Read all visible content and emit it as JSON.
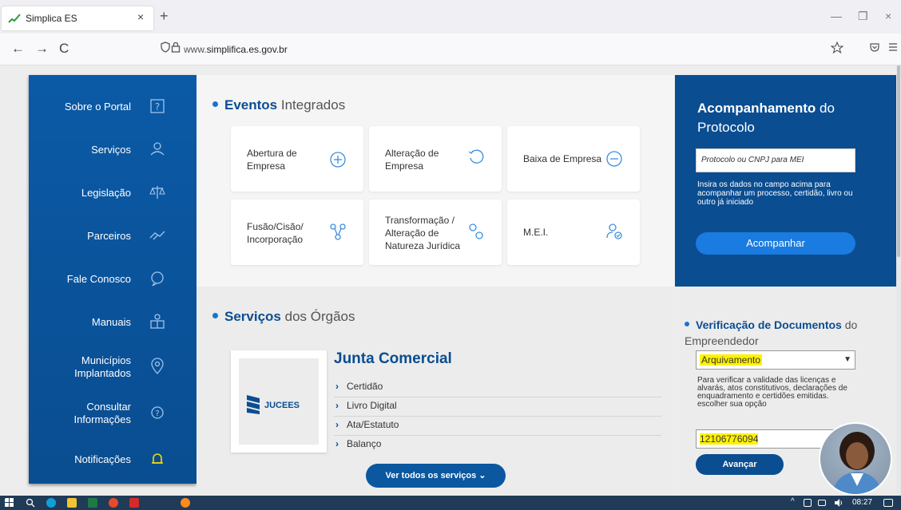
{
  "browser": {
    "tab_title": "Simplica ES",
    "tab_close": "×",
    "new_tab": "+",
    "url_host": "www.",
    "url_domain": "simplifica.es.gov.br",
    "back": "←",
    "forward": "→",
    "reload": "C",
    "minimize": "—",
    "restore": "❐",
    "close": "×",
    "bookmark_icon": "star-icon",
    "shield_icon": "shield-icon",
    "menu_icon": "hamburger-icon"
  },
  "sidebar": {
    "items": [
      {
        "label": "Sobre o Portal",
        "icon": "question-icon"
      },
      {
        "label": "Serviços",
        "icon": "user-service-icon"
      },
      {
        "label": "Legislação",
        "icon": "scales-icon"
      },
      {
        "label": "Parceiros",
        "icon": "handshake-icon"
      },
      {
        "label": "Fale Conosco",
        "icon": "chat-icon"
      },
      {
        "label": "Manuais",
        "icon": "book-icon"
      },
      {
        "label_line1": "Municípios",
        "label_line2": "Implantados",
        "icon": "location-icon"
      },
      {
        "label_line1": "Consultar",
        "label_line2": "Informações",
        "icon": "help-circle-icon"
      },
      {
        "label": "Notificações",
        "icon": "bell-icon"
      }
    ]
  },
  "eventos": {
    "title_bold": "Eventos",
    "title_rest": "Integrados",
    "cards": [
      {
        "line1": "Abertura de",
        "line2": "Empresa",
        "icon": "plus-circle-icon"
      },
      {
        "line1": "Alteração de",
        "line2": "Empresa",
        "icon": "refresh-icon"
      },
      {
        "line1": "Baixa de Empresa",
        "icon": "minus-circle-icon"
      },
      {
        "line1": "Fusão/Cisão/",
        "line2": "Incorporação",
        "icon": "merge-icon"
      },
      {
        "line1": "Transformação /",
        "line2": "Alteração de",
        "line3": "Natureza Jurídica",
        "icon": "transform-icon"
      },
      {
        "line1": "M.E.I.",
        "icon": "user-check-icon"
      }
    ]
  },
  "orgaos": {
    "title_bold": "Serviços",
    "title_rest": "dos Órgãos",
    "junta_title": "Junta Comercial",
    "logo_text": "JUCEES",
    "links": [
      "Certidão",
      "Livro Digital",
      "Ata/Estatuto",
      "Balanço"
    ],
    "ver_todos": "Ver todos os serviços",
    "ver_todos_arrow": "⌄"
  },
  "acompanhamento": {
    "title_bold": "Acompanhamento",
    "title_rest": "do Protocolo",
    "input_placeholder": "Protocolo ou CNPJ para MEI",
    "help": "Insira os dados no campo acima para acompanhar um processo, certidão, livro ou outro já iniciado",
    "button": "Acompanhar"
  },
  "verificacao": {
    "title_bold": "Verificação de Documentos",
    "title_rest": "do Empreendedor",
    "select_value": "Arquivamento",
    "help": "Para verificar a validade das licenças e alvarás, atos constitutivos, declarações de enquadramento e certidões emitidas. escolher sua opção",
    "input_value": "12106776094",
    "button": "Avançar"
  },
  "taskbar": {
    "time": "08:27"
  },
  "colors": {
    "brand_blue": "#0a4d91",
    "accent_blue": "#1a7be0",
    "highlight": "#fff200"
  }
}
